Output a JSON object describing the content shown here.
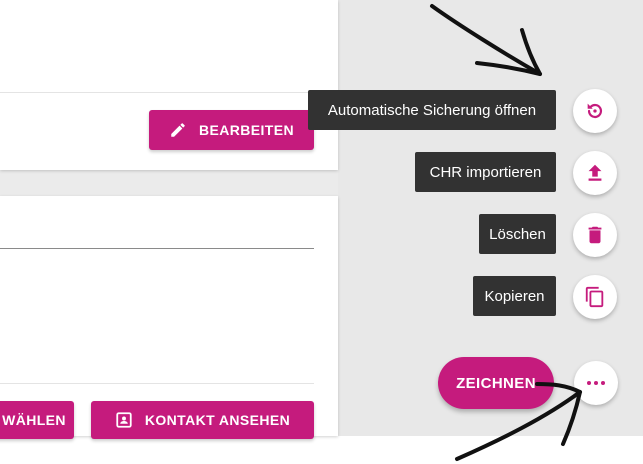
{
  "card1": {
    "edit_button_label": "BEARBEITEN",
    "edit_icon": "pencil-icon"
  },
  "card2": {
    "select_button_label": "WÄHLEN",
    "contact_button_label": "KONTAKT ANSEHEN",
    "contact_icon": "contact-card-icon"
  },
  "speed_dial": {
    "actions": [
      {
        "label": "Automatische Sicherung öffnen",
        "icon": "restore-icon"
      },
      {
        "label": "CHR importieren",
        "icon": "upload-icon"
      },
      {
        "label": "Löschen",
        "icon": "trash-icon"
      },
      {
        "label": "Kopieren",
        "icon": "copy-icon"
      }
    ],
    "main_button_label": "ZEICHNEN",
    "more_icon": "more-horizontal-icon"
  },
  "colors": {
    "accent": "#c51b7d",
    "tooltip_bg": "#323232",
    "panel_bg": "#e8e8e8"
  }
}
